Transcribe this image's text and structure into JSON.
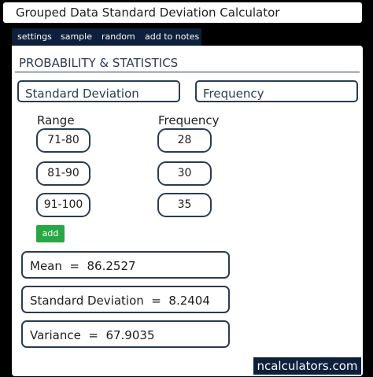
{
  "title": "Grouped Data Standard Deviation Calculator",
  "nav": [
    "settings",
    "sample",
    "random",
    "add to notes"
  ],
  "section": "PROBABILITY & STATISTICS",
  "modes": [
    "Standard Deviation",
    "Frequency"
  ],
  "columns": {
    "range": "Range",
    "frequency": "Frequency"
  },
  "rows": [
    {
      "range": "71-80",
      "frequency": "28"
    },
    {
      "range": "81-90",
      "frequency": "30"
    },
    {
      "range": "91-100",
      "frequency": "35"
    }
  ],
  "add_label": "add",
  "results": [
    {
      "label": "Mean",
      "value": "86.2527"
    },
    {
      "label": "Standard Deviation",
      "value": "8.2404"
    },
    {
      "label": "Variance",
      "value": "67.9035"
    }
  ],
  "brand": "ncalculators.com",
  "colors": {
    "navy": "#0d1f3a",
    "green": "#28a745",
    "border": "#2b3d4f"
  }
}
